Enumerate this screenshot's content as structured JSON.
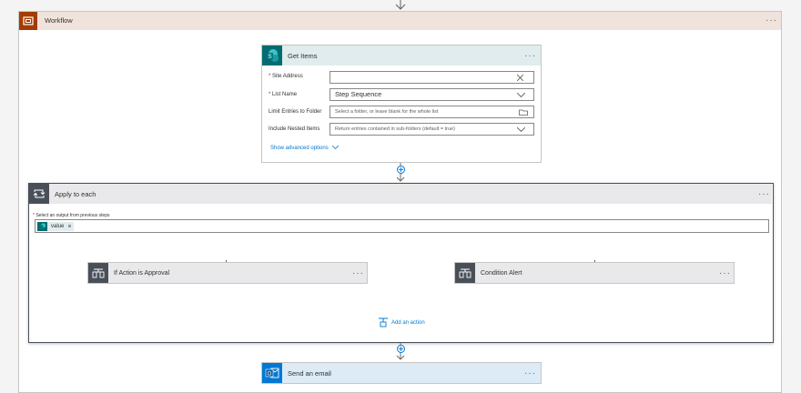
{
  "workflow": {
    "title": "Workflow",
    "more": "···"
  },
  "get_items": {
    "title": "Get Items",
    "more": "···",
    "fields": [
      {
        "required": true,
        "label": "Site Address",
        "value": ""
      },
      {
        "required": true,
        "label": "List Name",
        "value": "Step Sequence"
      },
      {
        "required": false,
        "label": "Limit Entries to Folder",
        "value": "Select a folder, or leave blank for the whole list"
      },
      {
        "required": false,
        "label": "Include Nested Items",
        "value": "Return entries contained in sub-folders (default = true)"
      }
    ],
    "advanced": "Show advanced options"
  },
  "apply_each": {
    "title": "Apply to each",
    "more": "···",
    "select_label": "Select an output from previous steps",
    "token": "value",
    "token_remove": "×",
    "branches": [
      {
        "title": "If Action is Approval",
        "more": "···"
      },
      {
        "title": "Condition Alert",
        "more": "···"
      }
    ],
    "add_action": "Add an action"
  },
  "send_email": {
    "title": "Send an email",
    "more": "···"
  },
  "colors": {
    "workflow_header": "#efe3dc",
    "workflow_icon": "#a33c00",
    "sharepoint_header": "#e0eced",
    "sharepoint_icon": "#036c70",
    "apply_header": "#e9e9eb",
    "loop_icon": "#484f58",
    "outlook_header": "#dcebf6",
    "outlook_icon": "#0078d4",
    "link": "#0078d4"
  }
}
